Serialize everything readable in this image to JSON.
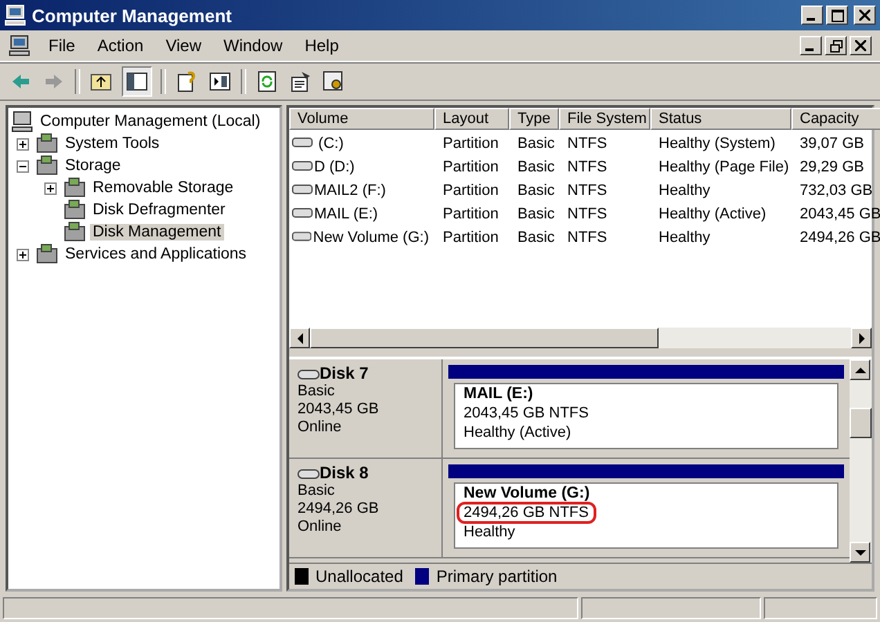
{
  "window": {
    "title": "Computer Management"
  },
  "menu": [
    "File",
    "Action",
    "View",
    "Window",
    "Help"
  ],
  "tree": [
    {
      "label": "Computer Management (Local)",
      "selected": false,
      "children": [
        {
          "label": "System Tools",
          "expanded": false,
          "selected": false
        },
        {
          "label": "Storage",
          "expanded": true,
          "selected": false,
          "children": [
            {
              "label": "Removable Storage",
              "expanded": false,
              "selected": false
            },
            {
              "label": "Disk Defragmenter",
              "selected": false
            },
            {
              "label": "Disk Management",
              "selected": true
            }
          ]
        },
        {
          "label": "Services and Applications",
          "expanded": false,
          "selected": false
        }
      ]
    }
  ],
  "table": {
    "columns": [
      "Volume",
      "Layout",
      "Type",
      "File System",
      "Status",
      "Capacity"
    ],
    "rows": [
      [
        " (C:)",
        "Partition",
        "Basic",
        "NTFS",
        "Healthy (System)",
        "39,07 GB"
      ],
      [
        "D (D:)",
        "Partition",
        "Basic",
        "NTFS",
        "Healthy (Page File)",
        "29,29 GB"
      ],
      [
        "MAIL2 (F:)",
        "Partition",
        "Basic",
        "NTFS",
        "Healthy",
        "732,03 GB"
      ],
      [
        "MAIL (E:)",
        "Partition",
        "Basic",
        "NTFS",
        "Healthy (Active)",
        "2043,45 GB"
      ],
      [
        "New Volume (G:)",
        "Partition",
        "Basic",
        "NTFS",
        "Healthy",
        "2494,26 GB"
      ]
    ]
  },
  "disks": [
    {
      "name": "Disk 7",
      "type": "Basic",
      "size": "2043,45 GB",
      "status": "Online",
      "partition": {
        "name": "MAIL  (E:)",
        "detail": "2043,45 GB NTFS",
        "status": "Healthy (Active)",
        "circled": false
      }
    },
    {
      "name": "Disk 8",
      "type": "Basic",
      "size": "2494,26 GB",
      "status": "Online",
      "partition": {
        "name": "New Volume  (G:)",
        "detail": "2494,26 GB NTFS",
        "status": "Healthy",
        "circled": true
      }
    }
  ],
  "legend": [
    {
      "label": "Unallocated",
      "color": "#000000"
    },
    {
      "label": "Primary partition",
      "color": "#000080"
    }
  ]
}
